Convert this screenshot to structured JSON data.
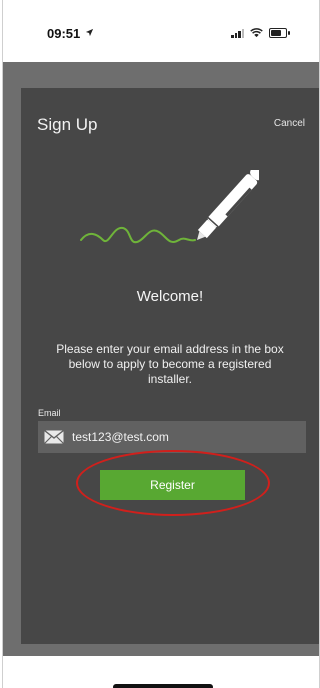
{
  "status_bar": {
    "time": "09:51",
    "icons": [
      "location-arrow-icon",
      "signal-icon",
      "wifi-icon",
      "battery-icon"
    ]
  },
  "dialog": {
    "title": "Sign Up",
    "cancel_label": "Cancel",
    "illustration": "pen-signature-illustration",
    "welcome": "Welcome!",
    "instructions": "Please enter your email address in the box below to apply to become a registered installer.",
    "email": {
      "label": "Email",
      "value": "test123@test.com",
      "icon": "mail-icon"
    },
    "register_label": "Register"
  },
  "colors": {
    "backdrop": "#6e6e6e",
    "dialog_bg": "#474747",
    "field_bg": "#616161",
    "accent_green": "#58a832",
    "annotation_red": "#d0201c"
  }
}
